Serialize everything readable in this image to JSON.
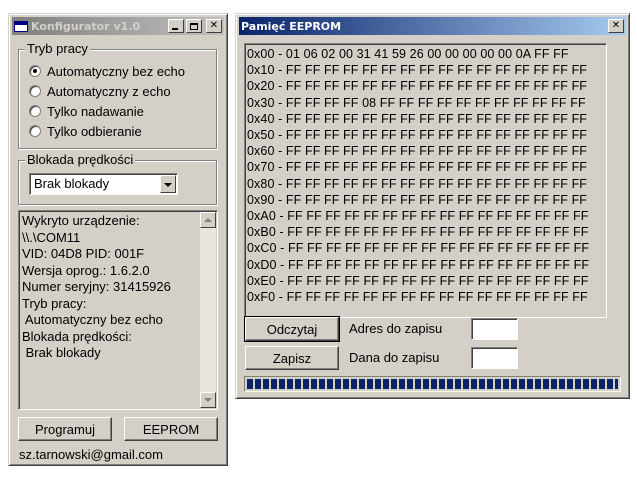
{
  "configurator": {
    "title": "Konfigurator v1.0",
    "mode_group": {
      "legend": "Tryb pracy",
      "options": [
        {
          "label": "Automatyczny bez echo",
          "checked": true
        },
        {
          "label": "Automatyczny z echo",
          "checked": false
        },
        {
          "label": "Tylko nadawanie",
          "checked": false
        },
        {
          "label": "Tylko odbieranie",
          "checked": false
        }
      ]
    },
    "speed_group": {
      "legend": "Blokada prędkości",
      "selected": "Brak blokady"
    },
    "info_lines": [
      "Wykryto urządzenie:",
      "\\\\.\\COM11",
      "VID: 04D8 PID: 001F",
      "Wersja oprog.: 1.6.2.0",
      "Numer seryjny: 31415926",
      "Tryb pracy:",
      " Automatyczny bez echo",
      "Blokada prędkości:",
      " Brak blokady"
    ],
    "program_button": "Programuj",
    "eeprom_button": "EEPROM",
    "email": "sz.tarnowski@gmail.com"
  },
  "eeprom": {
    "title": "Pamięć EEPROM",
    "rows": [
      "0x00 - 01 06 02 00 31 41 59 26 00 00 00 00 00 0A FF FF",
      "0x10 - FF FF FF FF FF FF FF FF FF FF FF FF FF FF FF FF",
      "0x20 - FF FF FF FF FF FF FF FF FF FF FF FF FF FF FF FF",
      "0x30 - FF FF FF FF 08 FF FF FF FF FF FF FF FF FF FF FF",
      "0x40 - FF FF FF FF FF FF FF FF FF FF FF FF FF FF FF FF",
      "0x50 - FF FF FF FF FF FF FF FF FF FF FF FF FF FF FF FF",
      "0x60 - FF FF FF FF FF FF FF FF FF FF FF FF FF FF FF FF",
      "0x70 - FF FF FF FF FF FF FF FF FF FF FF FF FF FF FF FF",
      "0x80 - FF FF FF FF FF FF FF FF FF FF FF FF FF FF FF FF",
      "0x90 - FF FF FF FF FF FF FF FF FF FF FF FF FF FF FF FF",
      "0xA0 - FF FF FF FF FF FF FF FF FF FF FF FF FF FF FF FF",
      "0xB0 - FF FF FF FF FF FF FF FF FF FF FF FF FF FF FF FF",
      "0xC0 - FF FF FF FF FF FF FF FF FF FF FF FF FF FF FF FF",
      "0xD0 - FF FF FF FF FF FF FF FF FF FF FF FF FF FF FF FF",
      "0xE0 - FF FF FF FF FF FF FF FF FF FF FF FF FF FF FF FF",
      "0xF0 - FF FF FF FF FF FF FF FF FF FF FF FF FF FF FF FF"
    ],
    "read_button": "Odczytaj",
    "write_button": "Zapisz",
    "address_label": "Adres do zapisu",
    "address_value": "",
    "data_label": "Dana do zapisu",
    "data_value": "",
    "progress_fraction": 1.0
  },
  "colors": {
    "face": "#d4d0c8",
    "active_title": "#0a246a",
    "inactive_title": "#808080"
  }
}
